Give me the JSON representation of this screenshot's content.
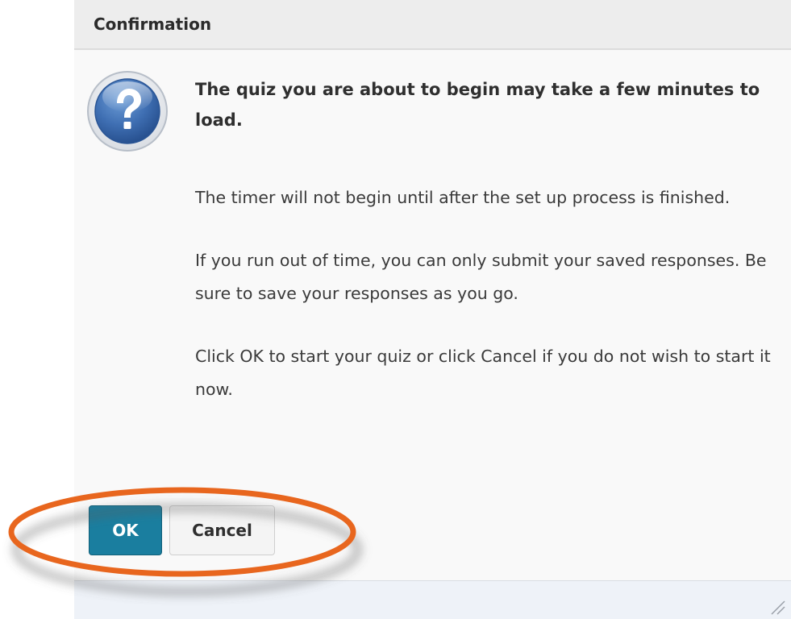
{
  "dialog": {
    "title": "Confirmation",
    "icon": "question-icon",
    "heading": "The quiz you are about to begin may take a few minutes to load.",
    "paragraphs": [
      "The timer will not begin until after the set up process is finished.",
      "If you run out of time, you can only submit your saved responses. Be sure to save your responses as you go.",
      "Click OK to start your quiz or click Cancel if you do not wish to start it now."
    ],
    "buttons": {
      "ok_label": "OK",
      "cancel_label": "Cancel"
    }
  },
  "annotation": {
    "shape": "ellipse",
    "target": "dialog buttons",
    "color": "#e8661e"
  },
  "colors": {
    "primary_button": "#1a7e9f",
    "header_background": "#ededed",
    "footer_background": "#eef2f8",
    "icon_blue": "#2f63a8"
  }
}
